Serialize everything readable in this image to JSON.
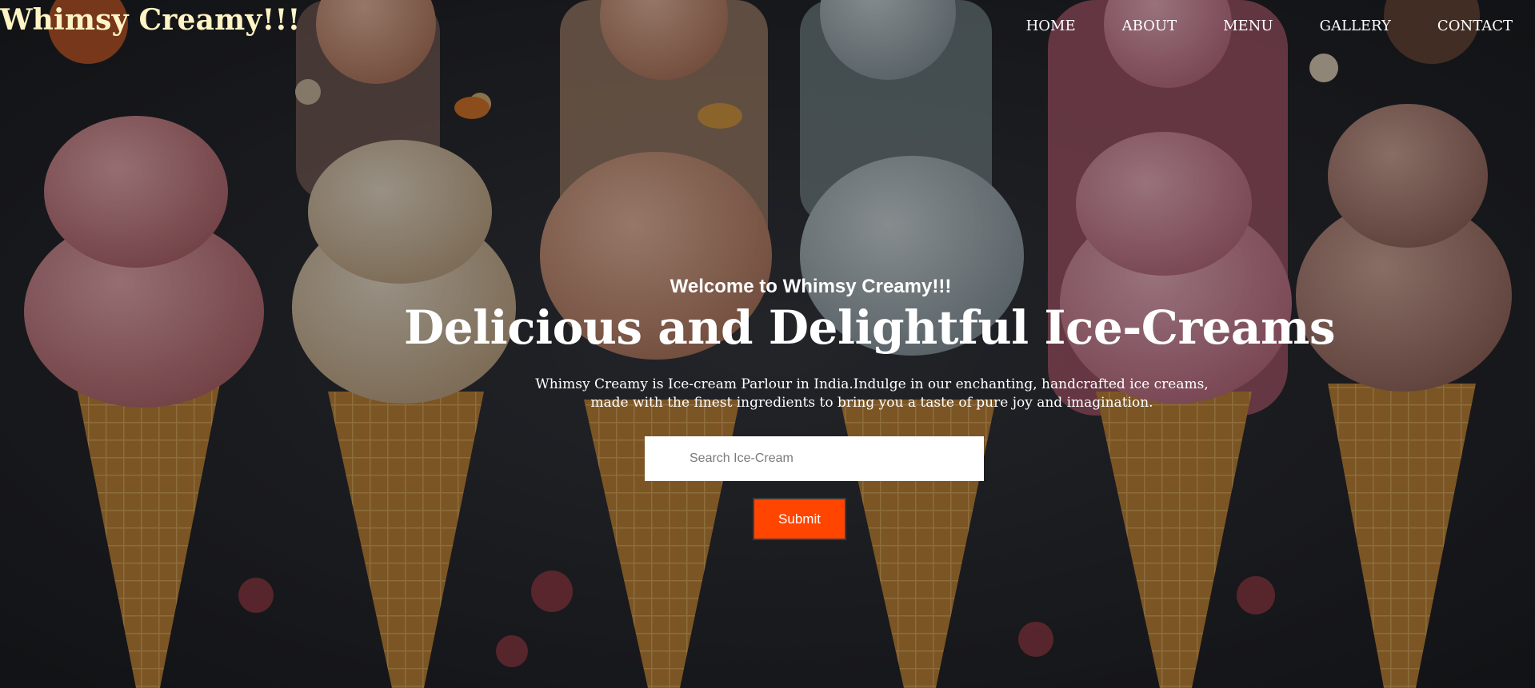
{
  "header": {
    "brand": "Whimsy Creamy!!!",
    "nav": [
      "HOME",
      "ABOUT",
      "MENU",
      "GALLERY",
      "CONTACT"
    ]
  },
  "hero": {
    "welcome": "Welcome to Whimsy Creamy!!!",
    "headline": "Delicious and Delightful Ice-Creams",
    "description": "Whimsy Creamy is Ice-cream Parlour in India.Indulge in our enchanting, handcrafted ice creams, made with the finest ingredients to bring you a taste of pure joy and imagination.",
    "search_placeholder": "Search Ice-Cream",
    "search_value": "",
    "submit_label": "Submit"
  },
  "colors": {
    "brand_text": "#fff4c4",
    "button": "#ff4500",
    "background": "#35383f"
  },
  "background_image": "ice-cream-cones-photo"
}
